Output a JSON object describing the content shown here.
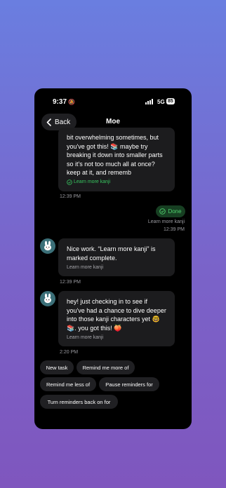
{
  "status_bar": {
    "time": "9:37",
    "network": "5G",
    "battery": "85"
  },
  "header": {
    "back_label": "Back",
    "title": "Moe"
  },
  "messages": {
    "first": {
      "text": "bit overwhelming sometimes, but you've got this! 📚 maybe try breaking it down into smaller parts so it's not too much all at once? keep at it, and rememb",
      "link": "Learn more kanji",
      "time": "12:39 PM"
    },
    "user": {
      "done_label": "Done",
      "subtitle": "Learn more kanji",
      "time": "12:39 PM"
    },
    "second": {
      "text": "Nice work. “Learn more kanji” is marked complete.",
      "subtitle": "Learn more kanji",
      "time": "12:39 PM"
    },
    "third": {
      "text": "hey! just checking in to see if you've had a chance to dive deeper into those kanji characters yet 🤓📚. you got this! 🍑",
      "subtitle": "Learn more kanji",
      "time": "2:20 PM"
    }
  },
  "quick_replies": [
    "New task",
    "Remind me more of",
    "Remind me less of",
    "Pause reminders for",
    "Turn reminders back on for"
  ],
  "colors": {
    "accent_green": "#4fd16e",
    "bubble": "#1c1c1e",
    "avatar_bg": "#3b6f78"
  },
  "icons": {
    "avatar": "rabbit-avatar-icon",
    "check": "check-circle-icon",
    "back": "chevron-left-icon"
  }
}
